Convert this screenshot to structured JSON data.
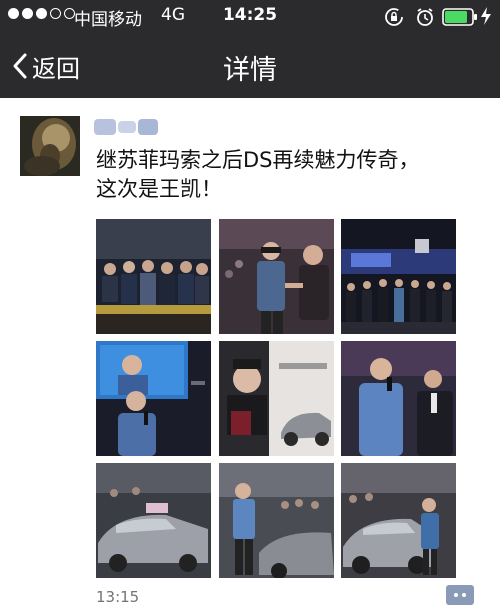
{
  "status_bar": {
    "carrier": "中国移动",
    "network": "4G",
    "time": "14:25",
    "signal_strength": 3,
    "signal_max": 5,
    "battery_level": 0.85,
    "icons": [
      "rotation-lock-icon",
      "alarm-icon",
      "battery-icon",
      "charging-icon"
    ]
  },
  "nav": {
    "back_label": "返回",
    "title": "详情",
    "back_icon": "chevron-left-icon"
  },
  "post": {
    "text_line1": "继苏菲玛索之后DS再续魅力传奇，",
    "text_line2": "这次是王凯！",
    "time": "13:15",
    "photos": [
      "photo-1",
      "photo-2",
      "photo-3",
      "photo-4",
      "photo-5",
      "photo-6",
      "photo-7",
      "photo-8",
      "photo-9"
    ],
    "comment_icon": "comment-dots-icon"
  },
  "colors": {
    "header_bg": "#2b2b2e",
    "battery_green": "#4cd964",
    "link_blue": "#576b95",
    "comment_button": "#8a9bb7",
    "time_gray": "#737373"
  }
}
